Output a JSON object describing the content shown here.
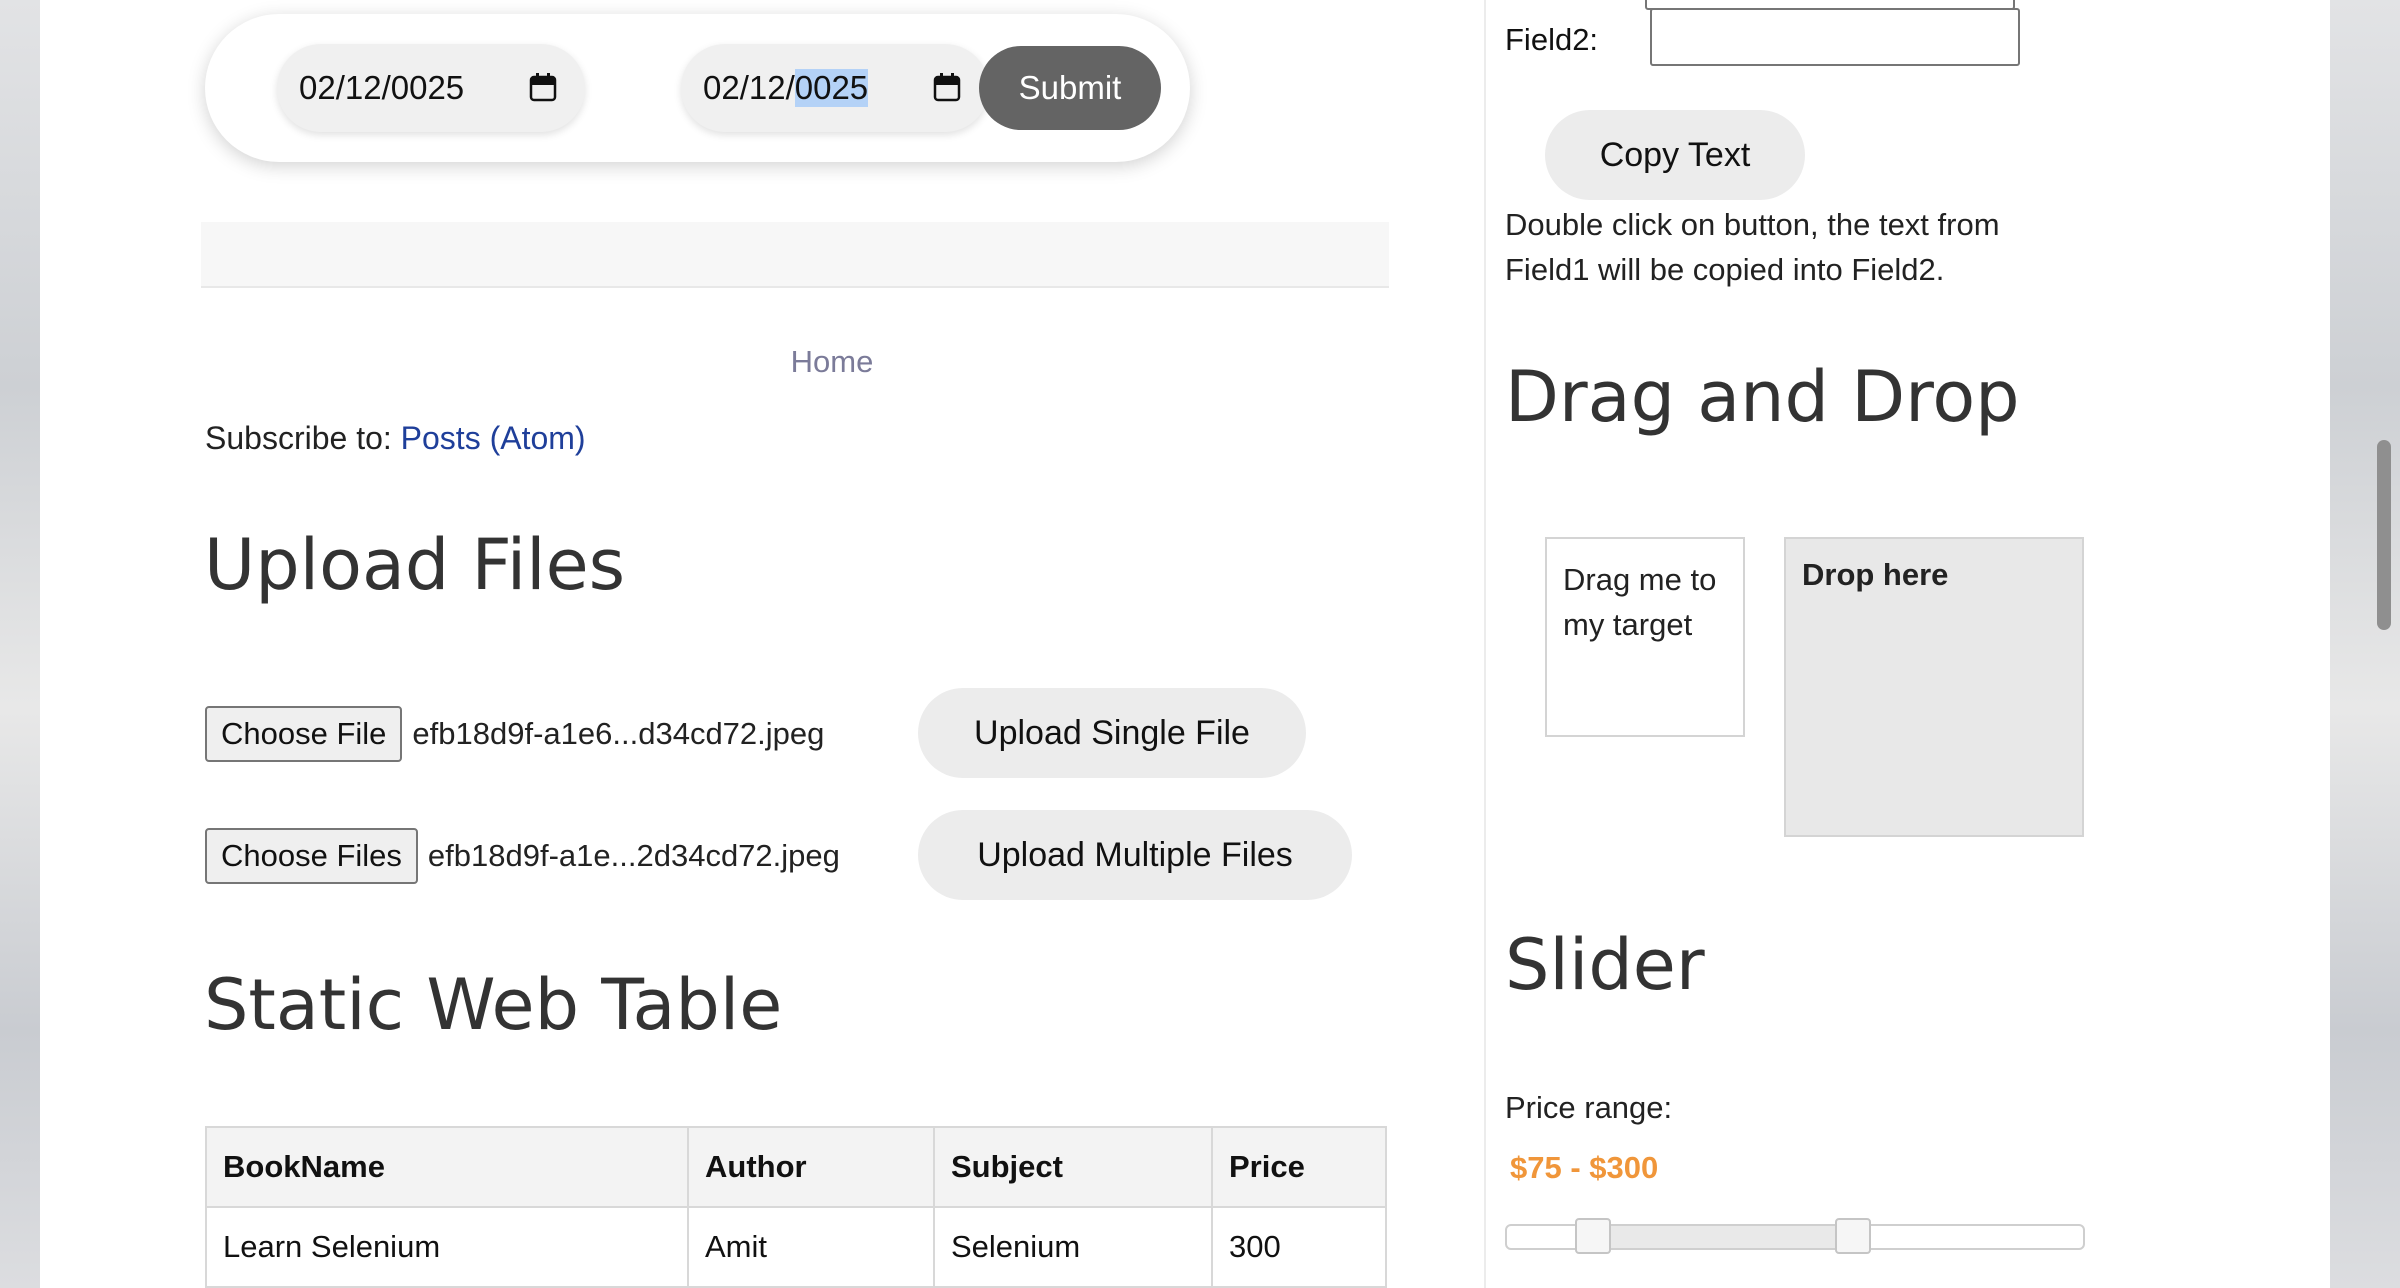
{
  "date_picker": {
    "start_value": "02/12/0025",
    "end_value_prefix": "02/12/",
    "end_value_selected": "0025",
    "submit_label": "Submit"
  },
  "nav": {
    "home_label": "Home",
    "subscribe_prefix": "Subscribe to: ",
    "subscribe_link": "Posts (Atom)"
  },
  "upload": {
    "title": "Upload Files",
    "single": {
      "choose_label": "Choose File",
      "file_name": "efb18d9f-a1e6...d34cd72.jpeg",
      "button_label": "Upload Single File"
    },
    "multiple": {
      "choose_label": "Choose Files",
      "file_name": "efb18d9f-a1e...2d34cd72.jpeg",
      "button_label": "Upload Multiple Files"
    }
  },
  "static_table": {
    "title": "Static Web Table",
    "headers": [
      "BookName",
      "Author",
      "Subject",
      "Price"
    ],
    "rows": [
      [
        "Learn Selenium",
        "Amit",
        "Selenium",
        "300"
      ]
    ]
  },
  "copy_text": {
    "field2_label": "Field2:",
    "button_label": "Copy Text",
    "help_text": "Double click on button, the text from Field1 will be copied into Field2."
  },
  "drag_drop": {
    "title": "Drag and Drop",
    "draggable_text": "Drag me to my target",
    "drop_text": "Drop here"
  },
  "slider": {
    "title": "Slider",
    "label": "Price range:",
    "value_text": "$75 - $300",
    "range_min": 0,
    "range_max": 500,
    "low": 75,
    "high": 300,
    "value_color": "#f0963a"
  },
  "colors": {
    "submit_bg": "#646464",
    "link": "#1f3f9a",
    "selection": "#b4d2f7"
  }
}
